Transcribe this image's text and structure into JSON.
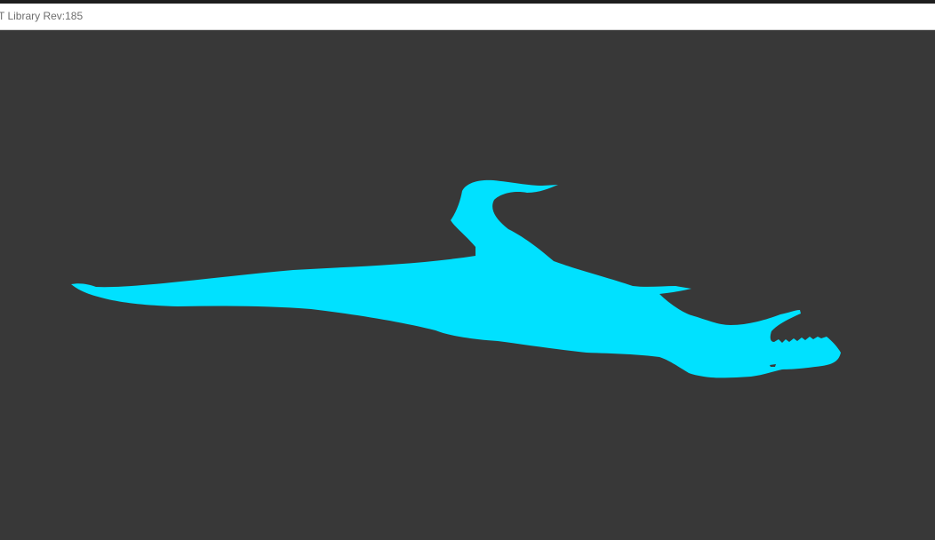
{
  "window": {
    "title": "T Library Rev:185"
  },
  "viewport": {
    "background_color": "#383838",
    "model": {
      "icon": "dinosaur-model",
      "color": "#00e1ff"
    }
  }
}
